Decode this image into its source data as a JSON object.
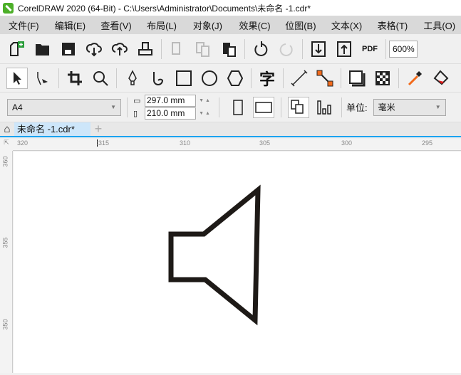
{
  "title": "CorelDRAW 2020 (64-Bit) - C:\\Users\\Administrator\\Documents\\未命名 -1.cdr*",
  "menu": [
    "文件(F)",
    "编辑(E)",
    "查看(V)",
    "布局(L)",
    "对象(J)",
    "效果(C)",
    "位图(B)",
    "文本(X)",
    "表格(T)",
    "工具(O)"
  ],
  "toolbar": {
    "zoom": "600%",
    "pdf": "PDF"
  },
  "toolbox": {
    "text_tool": "字"
  },
  "property_bar": {
    "page_size": "A4",
    "width": "297.0 mm",
    "height": "210.0 mm",
    "units_label": "单位:",
    "units": "毫米"
  },
  "tabs": [
    {
      "label": "未命名 -1.cdr*"
    }
  ],
  "ruler": {
    "h": [
      "320",
      "315",
      "310",
      "305",
      "300",
      "295"
    ],
    "v": [
      "360",
      "355",
      "350"
    ]
  }
}
